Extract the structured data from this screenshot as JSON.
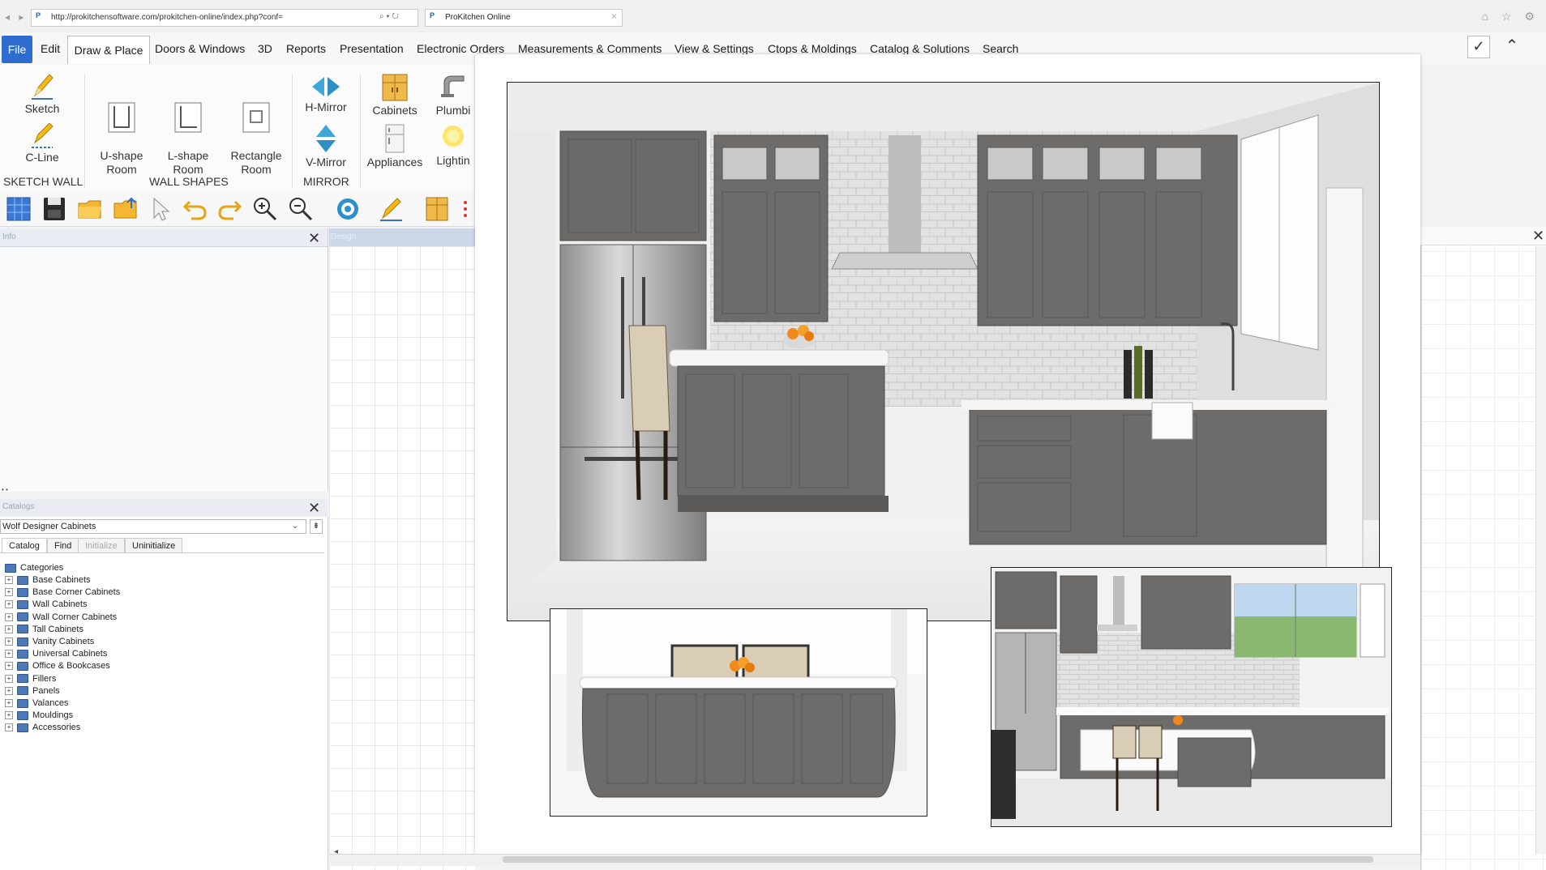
{
  "browser": {
    "url": "http://prokitchensoftware.com/prokitchen-online/index.php?conf=",
    "tab_title": "ProKitchen Online",
    "addr_controls": "⌕ ▾ ↻",
    "tab_close": "×",
    "nav": "◂ ▸",
    "window_controls": "⌂ ☆ ⚙"
  },
  "menu": {
    "tabs": [
      "File",
      "Edit",
      "Draw & Place",
      "Doors & Windows",
      "3D",
      "Reports",
      "Presentation",
      "Electronic Orders",
      "Measurements & Comments",
      "View & Settings",
      "Ctops & Moldings",
      "Catalog & Solutions",
      "Search"
    ],
    "active": "Draw & Place",
    "confirm": "✓",
    "collapse": "⌃"
  },
  "ribbon": {
    "sketch": "Sketch",
    "c_line": "C-Line",
    "u_shape": "U-shape\nRoom",
    "l_shape": "L-shape\nRoom",
    "rectangle": "Rectangle\nRoom",
    "h_mirror": "H-Mirror",
    "v_mirror": "V-Mirror",
    "cabinets": "Cabinets",
    "appliances": "Appliances",
    "plumbing": "Plumbi",
    "lighting": "Lightin",
    "groups": {
      "sketch_wall": "SKETCH WALL",
      "wall_shapes": "WALL SHAPES",
      "mirror": "MIRROR"
    }
  },
  "panels": {
    "info_title": "Info",
    "design_title": "Design",
    "catalog_title": "Catalogs",
    "close": "✕",
    "splitter": "• •",
    "scroll_left": "◂"
  },
  "catalog": {
    "selected": "Wolf Designer Cabinets",
    "select_arrow": "⌄",
    "pin": "⇟",
    "tabs": [
      "Catalog",
      "Find",
      "Initialize",
      "Uninitialize"
    ],
    "root": "Categories",
    "categories": [
      "Base Cabinets",
      "Base Corner Cabinets",
      "Wall Cabinets",
      "Wall Corner Cabinets",
      "Tall Cabinets",
      "Vanity Cabinets",
      "Universal Cabinets",
      "Office & Bookcases",
      "Fillers",
      "Panels",
      "Valances",
      "Mouldings",
      "Accessories"
    ]
  },
  "colors": {
    "accent": "#2e6dcf",
    "cabinet_gray": "#6e6c6b",
    "countertop": "#f4f4f4",
    "backsplash": "#d9d9d9"
  }
}
